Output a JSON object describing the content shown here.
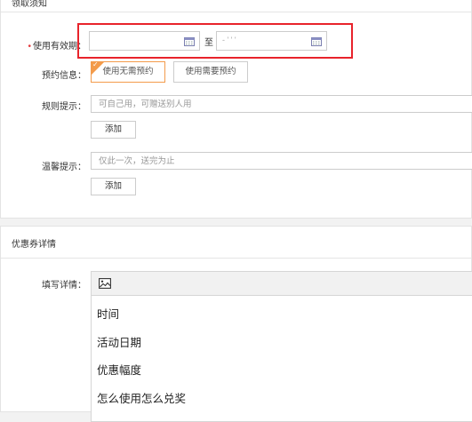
{
  "rules_section": {
    "title": "领取须知"
  },
  "validity": {
    "label": "使用有效期：",
    "required_mark": "•",
    "start_value": "",
    "end_value": "- ' ' '",
    "separator": "至",
    "icon": "calendar-icon"
  },
  "reservation": {
    "label": "预约信息：",
    "options": [
      {
        "label": "使用无需预约",
        "selected": true
      },
      {
        "label": "使用需要预约",
        "selected": false
      }
    ]
  },
  "rule_tip": {
    "label": "规则提示：",
    "placeholder": "可自己用，可赠送别人用",
    "add_label": "添加"
  },
  "warm_tip": {
    "label": "温馨提示：",
    "placeholder": "仅此一次，送完为止",
    "add_label": "添加"
  },
  "detail_section": {
    "title": "优惠券详情"
  },
  "detail_editor": {
    "label": "填写详情：",
    "toolbar_icon": "image-icon",
    "lines": [
      "时间",
      "活动日期",
      "优惠幅度",
      "怎么使用怎么兑奖"
    ]
  },
  "colors": {
    "highlight_border": "#e8232b",
    "selected_option": "#f39b4b",
    "required": "#e4393c"
  }
}
